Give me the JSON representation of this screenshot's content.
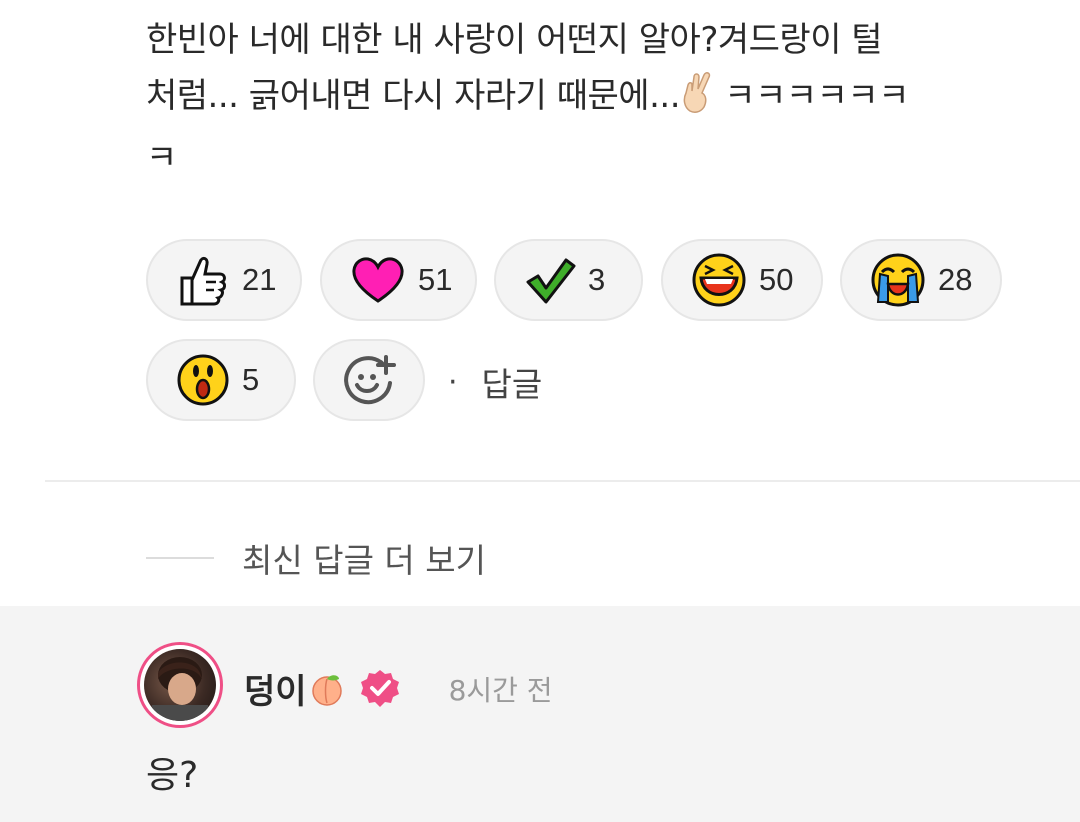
{
  "comment": {
    "line1": "한빈아 너에 대한 내 사랑이 어떤지 알아?겨드랑이 털",
    "line2_before_emoji": "처럼... 긁어내면 다시 자라기 때문에...",
    "line2_after_emoji": " ㅋㅋㅋㅋㅋㅋ",
    "line3": "ㅋ",
    "emoji": "finger-heart-emoji"
  },
  "reactions": [
    {
      "icon": "thumbs-up-icon",
      "count": "21"
    },
    {
      "icon": "heart-icon",
      "count": "51"
    },
    {
      "icon": "checkmark-icon",
      "count": "3"
    },
    {
      "icon": "laughing-face-icon",
      "count": "50"
    },
    {
      "icon": "crying-face-icon",
      "count": "28"
    },
    {
      "icon": "surprised-face-icon",
      "count": "5"
    },
    {
      "icon": "add-reaction-icon",
      "count": ""
    }
  ],
  "actions": {
    "reply_dot": "·",
    "reply_label": "답글"
  },
  "more_replies": {
    "label": "최신 답글 더 보기"
  },
  "reply": {
    "author": "덩이",
    "author_emoji": "peach-emoji",
    "verified": "verified-badge-icon",
    "time": "8시간 전",
    "text": "응?"
  },
  "colors": {
    "heart": "#ff1fb4",
    "check": "#3fae2a",
    "verified": "#ef4f86",
    "reply_bg": "#f4f4f4"
  }
}
